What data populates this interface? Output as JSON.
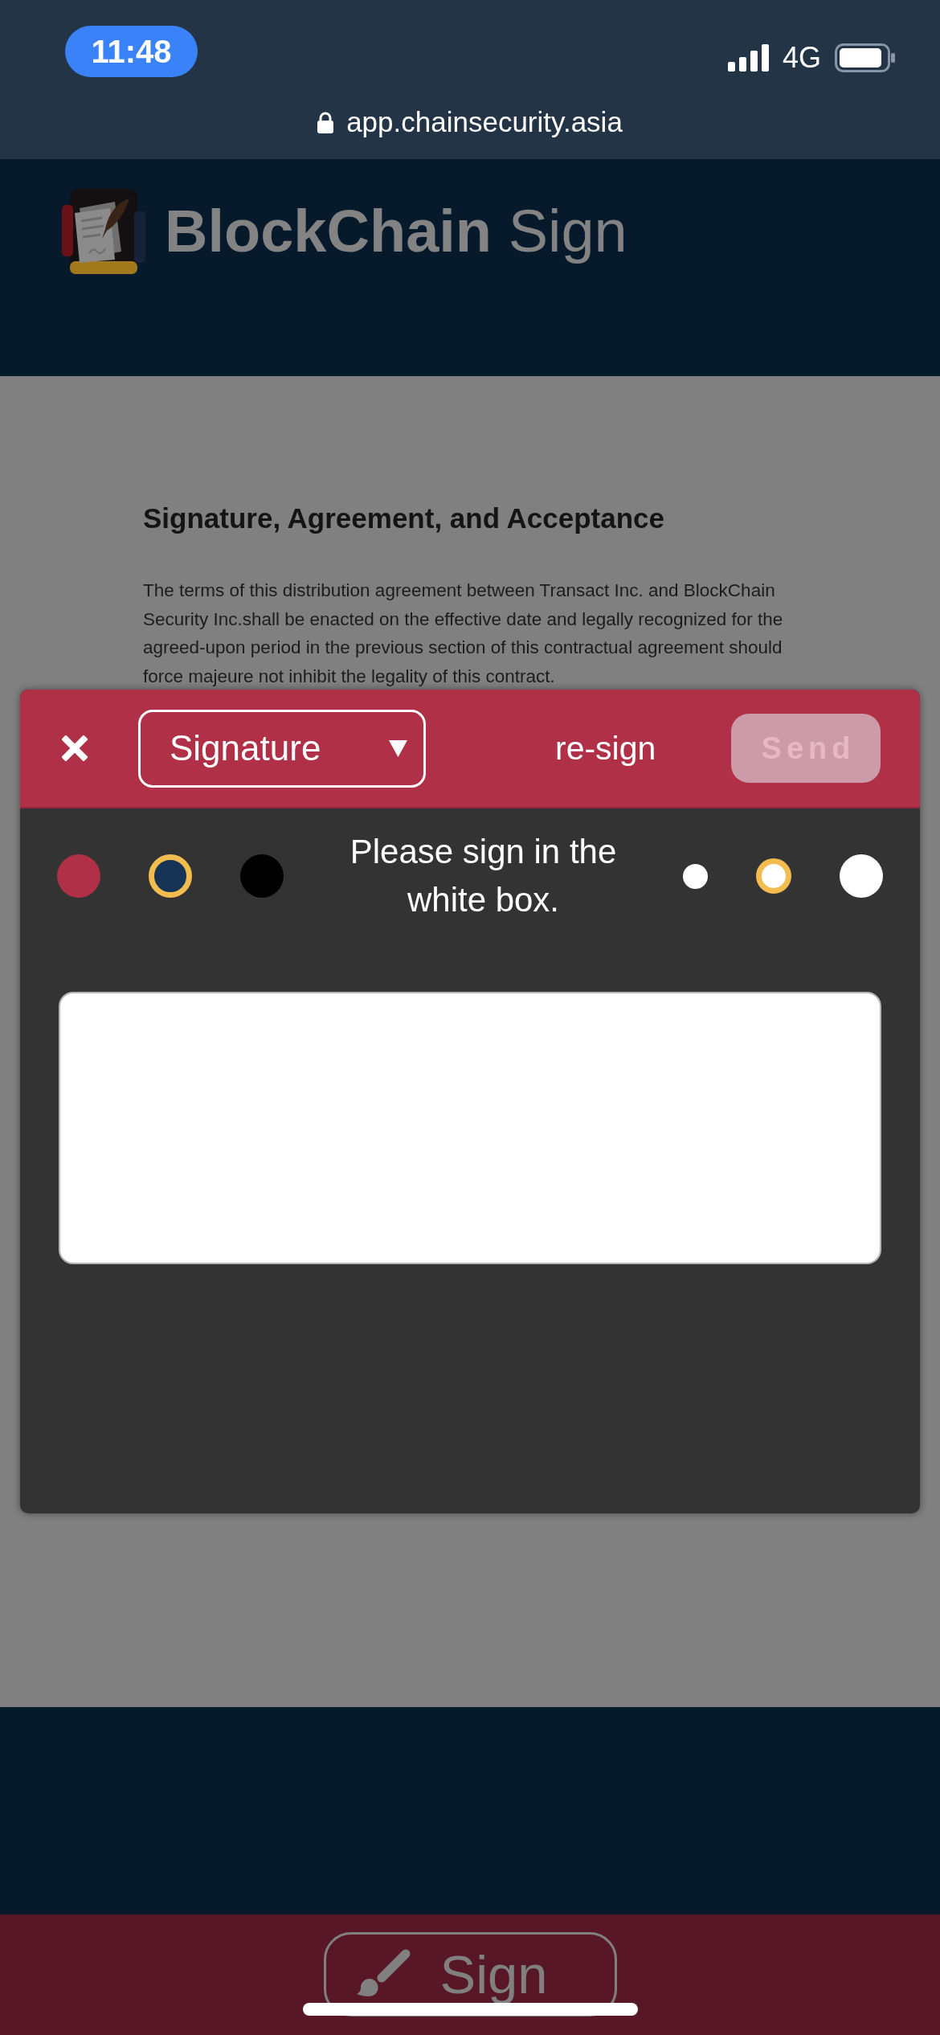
{
  "status_bar": {
    "time": "11:48",
    "network": "4G"
  },
  "address_bar": {
    "url": "app.chainsecurity.asia"
  },
  "header": {
    "logo": "**BlockChain** Sign"
  },
  "document": {
    "heading": "Signature, Agreement, and Acceptance",
    "paragraph": "The terms of this distribution agreement between Transact Inc. and BlockChain Security Inc.shall be enacted on the effective date and legally recognized for the agreed-upon period in the previous section of this contractual agreement should force majeure not inhibit the legality of this contract."
  },
  "dialog": {
    "type_select": {
      "value": "Signature"
    },
    "resign": "re-sign",
    "send": {
      "label": "Send",
      "disabled": true
    },
    "colors": [
      {
        "color": "#b03048",
        "selected": false
      },
      {
        "color": "#163456",
        "selected": true
      },
      {
        "color": "#000000",
        "selected": false
      }
    ],
    "instruction": "Please sign in the white box.",
    "pen_sizes": [
      {
        "kind": "small",
        "selected": false
      },
      {
        "kind": "medium",
        "selected": true
      },
      {
        "kind": "large",
        "selected": false
      }
    ]
  },
  "bottom_bar": {
    "sign_button": "Sign"
  }
}
